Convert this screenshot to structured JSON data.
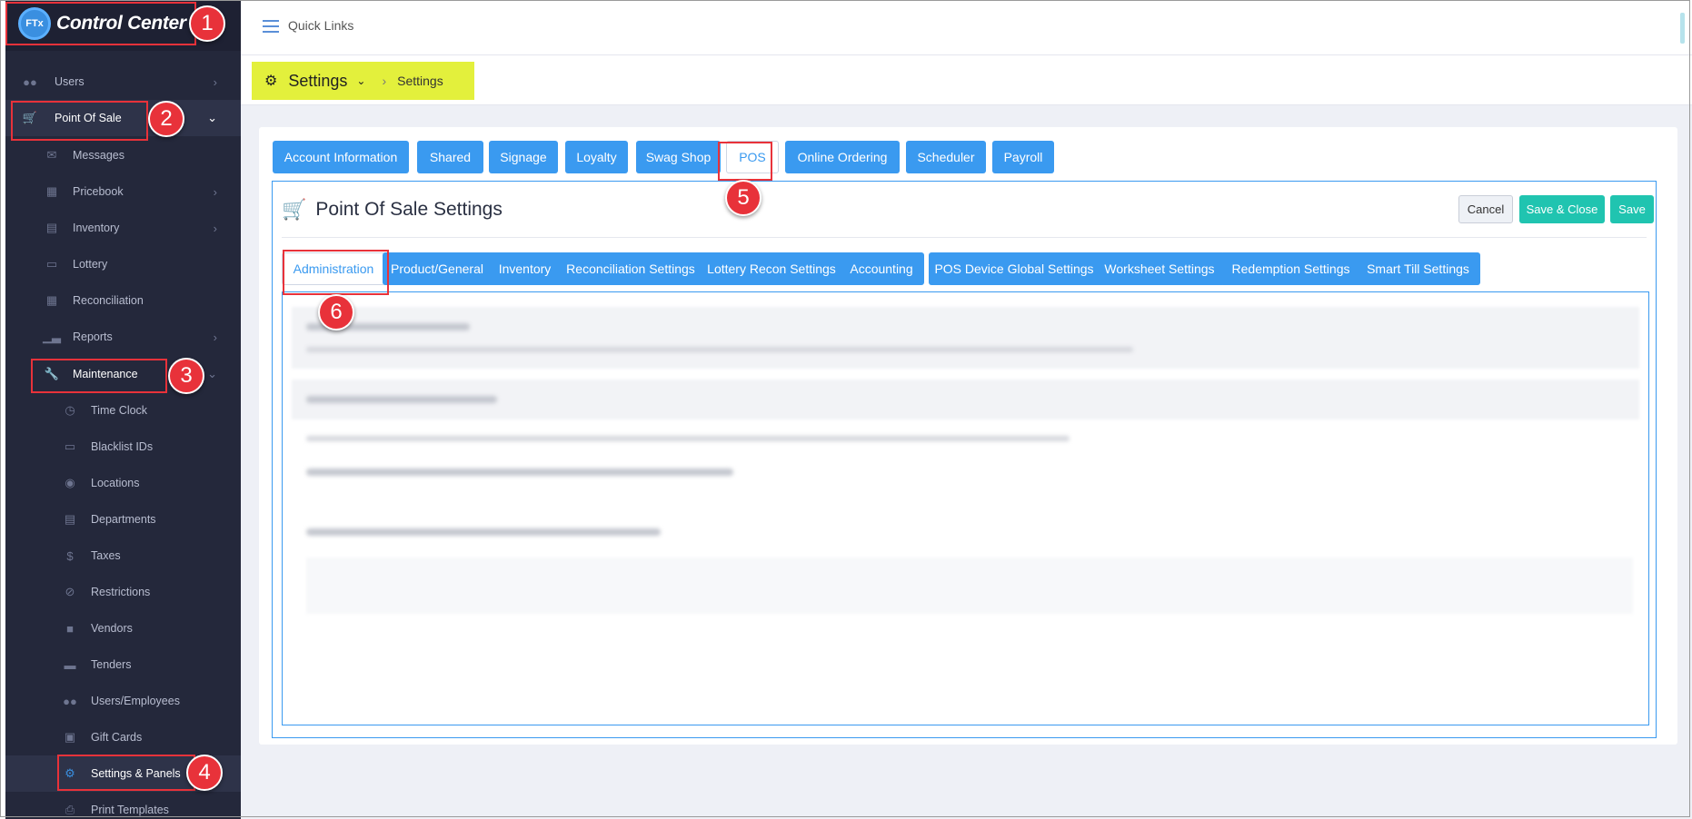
{
  "app": {
    "title": "Control Center",
    "logo_badge": "FTx"
  },
  "sidebar": {
    "items": [
      {
        "label": "Users",
        "icon": "users-icon"
      },
      {
        "label": "Point Of Sale",
        "icon": "cart-icon"
      },
      {
        "label": "Messages",
        "icon": "message-icon"
      },
      {
        "label": "Pricebook",
        "icon": "calculator-icon"
      },
      {
        "label": "Inventory",
        "icon": "inventory-icon"
      },
      {
        "label": "Lottery",
        "icon": "ticket-icon"
      },
      {
        "label": "Reconciliation",
        "icon": "grid-icon"
      },
      {
        "label": "Reports",
        "icon": "chart-icon"
      },
      {
        "label": "Maintenance",
        "icon": "wrench-icon"
      },
      {
        "label": "Time Clock",
        "icon": "clock-icon"
      },
      {
        "label": "Blacklist IDs",
        "icon": "id-card-icon"
      },
      {
        "label": "Locations",
        "icon": "pin-icon"
      },
      {
        "label": "Departments",
        "icon": "building-icon"
      },
      {
        "label": "Taxes",
        "icon": "dollar-icon"
      },
      {
        "label": "Restrictions",
        "icon": "ban-icon"
      },
      {
        "label": "Vendors",
        "icon": "contact-icon"
      },
      {
        "label": "Tenders",
        "icon": "cash-icon"
      },
      {
        "label": "Users/Employees",
        "icon": "users-icon"
      },
      {
        "label": "Gift Cards",
        "icon": "gift-icon"
      },
      {
        "label": "Settings & Panels",
        "icon": "gear-icon"
      },
      {
        "label": "Print Templates",
        "icon": "print-icon"
      }
    ]
  },
  "topbar": {
    "quick_links": "Quick Links"
  },
  "breadcrumb": {
    "title": "Settings",
    "current": "Settings"
  },
  "tabs": [
    "Account Information",
    "Shared",
    "Signage",
    "Loyalty",
    "Swag Shop",
    "POS",
    "Online Ordering",
    "Scheduler",
    "Payroll"
  ],
  "panel": {
    "title": "Point Of Sale Settings",
    "cancel": "Cancel",
    "save_close": "Save & Close",
    "save": "Save"
  },
  "sub_tabs": [
    "Administration",
    "Product/General",
    "Inventory",
    "Reconciliation Settings",
    "Lottery Recon Settings",
    "Accounting",
    "POS Device Global Settings",
    "Worksheet Settings",
    "Redemption Settings",
    "Smart Till Settings"
  ],
  "annotations": [
    "1",
    "2",
    "3",
    "4",
    "5",
    "6"
  ],
  "colors": {
    "primary": "#3a9af0",
    "teal": "#20c4b0",
    "sidebar": "#24283b",
    "highlight": "#e3f03c",
    "annotation": "#e8323a"
  }
}
